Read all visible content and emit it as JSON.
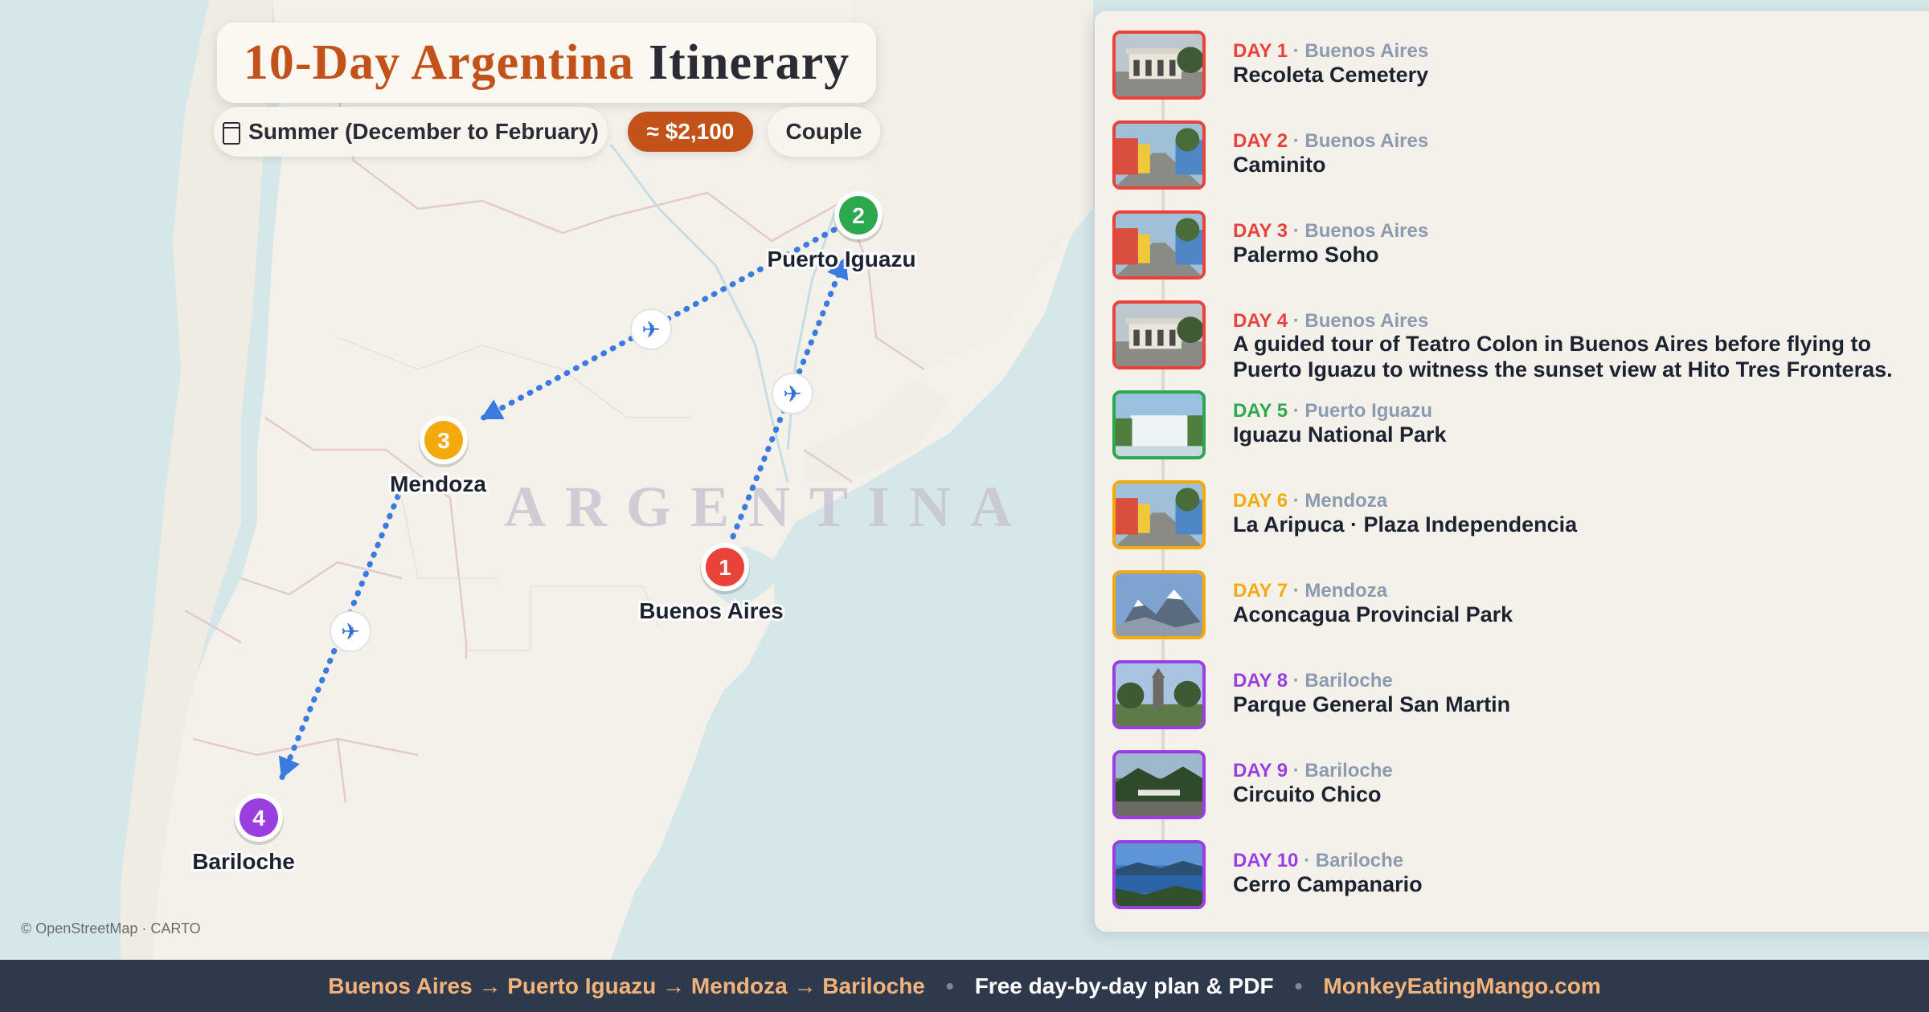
{
  "title": {
    "part1": "10-Day Argentina",
    "part2": "Itinerary"
  },
  "meta": {
    "season": "Summer (December to February)",
    "cost": "≈ $2,100",
    "travelers": "Couple"
  },
  "map": {
    "country_label": "ARGENTINA",
    "attribution": "© OpenStreetMap · CARTO",
    "stops": [
      {
        "num": "1",
        "name": "Buenos Aires",
        "color": "#e8423b"
      },
      {
        "num": "2",
        "name": "Puerto Iguazu",
        "color": "#2ea84f"
      },
      {
        "num": "3",
        "name": "Mendoza",
        "color": "#f4aa0c"
      },
      {
        "num": "4",
        "name": "Bariloche",
        "color": "#9b3ee0"
      }
    ],
    "transport_icon": "airplane-icon",
    "route_color": "#3b7ae0"
  },
  "days": [
    {
      "day": "DAY 1",
      "city": "Buenos Aires",
      "name": "Recoleta Cemetery",
      "color": "#e8423b",
      "photo": "building-photo"
    },
    {
      "day": "DAY 2",
      "city": "Buenos Aires",
      "name": "Caminito",
      "color": "#e8423b",
      "photo": "street-photo"
    },
    {
      "day": "DAY 3",
      "city": "Buenos Aires",
      "name": "Palermo Soho",
      "color": "#e8423b",
      "photo": "street-photo"
    },
    {
      "day": "DAY 4",
      "city": "Buenos Aires",
      "name": "A guided tour of Teatro Colon in Buenos Aires before flying to Puerto Iguazu to witness the sunset view at Hito Tres Fronteras.",
      "color": "#e8423b",
      "photo": "building-photo"
    },
    {
      "day": "DAY 5",
      "city": "Puerto Iguazu",
      "name": "Iguazu National Park",
      "color": "#2ea84f",
      "photo": "waterfall-photo"
    },
    {
      "day": "DAY 6",
      "city": "Mendoza",
      "name": "La Aripuca · Plaza Independencia",
      "color": "#f4aa0c",
      "photo": "street-photo"
    },
    {
      "day": "DAY 7",
      "city": "Mendoza",
      "name": "Aconcagua Provincial Park",
      "color": "#f4aa0c",
      "photo": "mountain-photo"
    },
    {
      "day": "DAY 8",
      "city": "Bariloche",
      "name": "Parque General San Martin",
      "color": "#9b3ee0",
      "photo": "park-photo"
    },
    {
      "day": "DAY 9",
      "city": "Bariloche",
      "name": "Circuito Chico",
      "color": "#9b3ee0",
      "photo": "forest-photo"
    },
    {
      "day": "DAY 10",
      "city": "Bariloche",
      "name": "Cerro Campanario",
      "color": "#9b3ee0",
      "photo": "lake-photo"
    }
  ],
  "footer": {
    "route": "Buenos Aires → Puerto Iguazu → Mendoza → Bariloche",
    "separator": "•",
    "free_text": "Free day-by-day plan & PDF",
    "site": "MonkeyEatingMango.com"
  }
}
